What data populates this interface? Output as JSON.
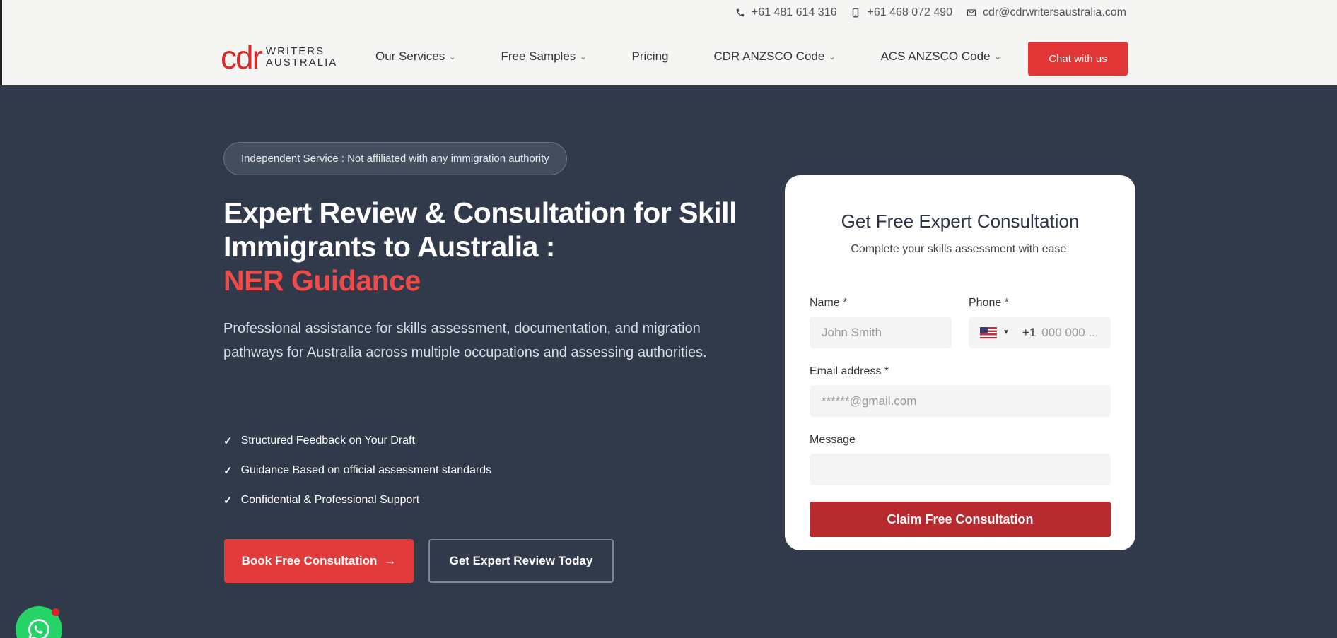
{
  "topbar": {
    "phone1": "+61 481 614 316",
    "phone2": "+61 468 072 490",
    "email": "cdr@cdrwritersaustralia.com"
  },
  "logo": {
    "mark": "cdr",
    "line1": "WRITERS",
    "line2": "AUSTRALIA"
  },
  "nav": {
    "items": [
      {
        "label": "Our Services",
        "dropdown": true
      },
      {
        "label": "Free Samples",
        "dropdown": true
      },
      {
        "label": "Pricing",
        "dropdown": false
      },
      {
        "label": "CDR ANZSCO Code",
        "dropdown": true
      },
      {
        "label": "ACS ANZSCO Code",
        "dropdown": true
      }
    ],
    "cta": "Chat with us"
  },
  "hero": {
    "badge": "Independent Service : Not affiliated with any immigration authority",
    "title_line1": "Expert Review & Consultation for Skill",
    "title_line2": "Immigrants to Australia :",
    "title_accent": "NER Guidance",
    "subtitle": "Professional assistance for skills assessment, documentation, and migration pathways for Australia across multiple occupations and assessing authorities.",
    "features": [
      "Structured Feedback on Your Draft",
      "Guidance Based on official assessment standards",
      "Confidential & Professional Support"
    ],
    "check_glyph": "✓",
    "primary_button": "Book Free Consultation",
    "primary_arrow": "→",
    "secondary_button": "Get Expert Review Today"
  },
  "form": {
    "title": "Get Free Expert Consultation",
    "subtitle": "Complete your skills assessment with ease.",
    "name_label": "Name *",
    "name_placeholder": "John Smith",
    "phone_label": "Phone *",
    "phone_code": "+1",
    "phone_placeholder": "000 000 ...",
    "email_label": "Email address *",
    "email_placeholder": "******@gmail.com",
    "message_label": "Message",
    "message_placeholder": "",
    "submit": "Claim Free Consultation"
  },
  "colors": {
    "brand_red": "#e23535",
    "hero_bg": "#313a4b",
    "accent_text": "#ef4b4b",
    "submit_red": "#b72a2e",
    "whatsapp_green": "#25d366"
  }
}
